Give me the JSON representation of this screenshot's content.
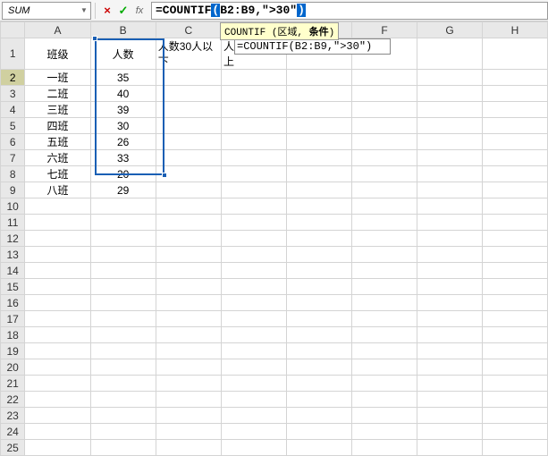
{
  "formula_bar": {
    "name_box": "SUM",
    "cancel": "×",
    "confirm": "✓",
    "fx": "fx",
    "formula_prefix": "=COUNTIF",
    "formula_open": "(",
    "formula_args": "B2:B9,\">30\"",
    "formula_close": ")"
  },
  "tooltip": {
    "fn": "COUNTIF",
    "sig_open": " (",
    "arg1": "区域",
    "comma": ", ",
    "arg2": "条件",
    "sig_close": ")"
  },
  "columns": [
    "A",
    "B",
    "C",
    "D",
    "E",
    "F",
    "G",
    "H"
  ],
  "rows": {
    "1": {
      "A": "班级",
      "B": "人数",
      "C": "人数30人以下",
      "D": "人数30人以上"
    },
    "2": {
      "A": "一班",
      "B": "35",
      "D": "=COUNTIF(B2:B9,\">30\")"
    },
    "3": {
      "A": "二班",
      "B": "40"
    },
    "4": {
      "A": "三班",
      "B": "39"
    },
    "5": {
      "A": "四班",
      "B": "30"
    },
    "6": {
      "A": "五班",
      "B": "26"
    },
    "7": {
      "A": "六班",
      "B": "33"
    },
    "8": {
      "A": "七班",
      "B": "20"
    },
    "9": {
      "A": "八班",
      "B": "29"
    }
  },
  "active_cell_ref": "D2",
  "selected_range": "B2:B9",
  "visible_rows": 25
}
